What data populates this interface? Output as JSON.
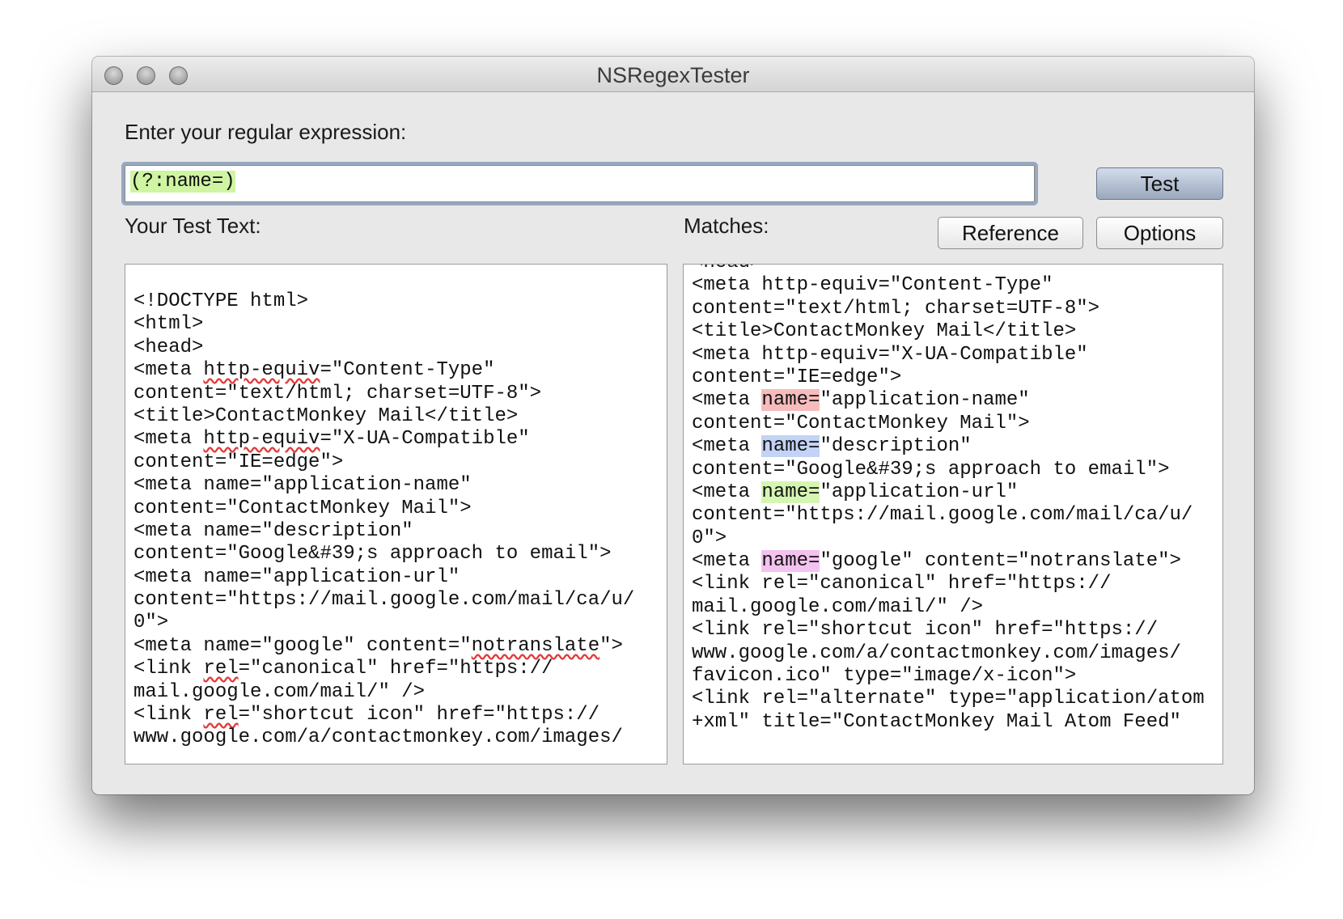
{
  "window": {
    "title": "NSRegexTester"
  },
  "regex": {
    "label": "Enter your regular expression:",
    "value": "(?:name=)"
  },
  "buttons": {
    "test": "Test",
    "reference": "Reference",
    "options": "Options"
  },
  "test_text": {
    "label": "Your Test Text:",
    "lines": [
      "<!DOCTYPE html>",
      "<html>",
      "<head>",
      "<meta http-equiv=\"Content-Type\"",
      "content=\"text/html; charset=UTF-8\">",
      "<title>ContactMonkey Mail</title>",
      "<meta http-equiv=\"X-UA-Compatible\"",
      "content=\"IE=edge\">",
      "<meta name=\"application-name\"",
      "content=\"ContactMonkey Mail\">",
      "<meta name=\"description\"",
      "content=\"Google&#39;s approach to email\">",
      "<meta name=\"application-url\"",
      "content=\"https://mail.google.com/mail/ca/u/",
      "0\">",
      "<meta name=\"google\" content=\"notranslate\">",
      "<link rel=\"canonical\" href=\"https://",
      "mail.google.com/mail/\" />",
      "<link rel=\"shortcut icon\" href=\"https://",
      "www.google.com/a/contactmonkey.com/images/"
    ]
  },
  "matches": {
    "label": "Matches:",
    "lines": [
      "<head>",
      "<meta http-equiv=\"Content-Type\"",
      "content=\"text/html; charset=UTF-8\">",
      "<title>ContactMonkey Mail</title>",
      "<meta http-equiv=\"X-UA-Compatible\"",
      "content=\"IE=edge\">",
      "<meta name=\"application-name\"",
      "content=\"ContactMonkey Mail\">",
      "<meta name=\"description\"",
      "content=\"Google&#39;s approach to email\">",
      "<meta name=\"application-url\"",
      "content=\"https://mail.google.com/mail/ca/u/",
      "0\">",
      "<meta name=\"google\" content=\"notranslate\">",
      "<link rel=\"canonical\" href=\"https://",
      "mail.google.com/mail/\" />",
      "<link rel=\"shortcut icon\" href=\"https://",
      "www.google.com/a/contactmonkey.com/images/",
      "favicon.ico\" type=\"image/x-icon\">",
      "<link rel=\"alternate\" type=\"application/atom",
      "+xml\" title=\"ContactMonkey Mail Atom Feed\""
    ],
    "highlight_colors": [
      "#f6bcbc",
      "#c3d3f5",
      "#d6f5b3",
      "#f3c2ef"
    ],
    "highlight_token": "name="
  }
}
